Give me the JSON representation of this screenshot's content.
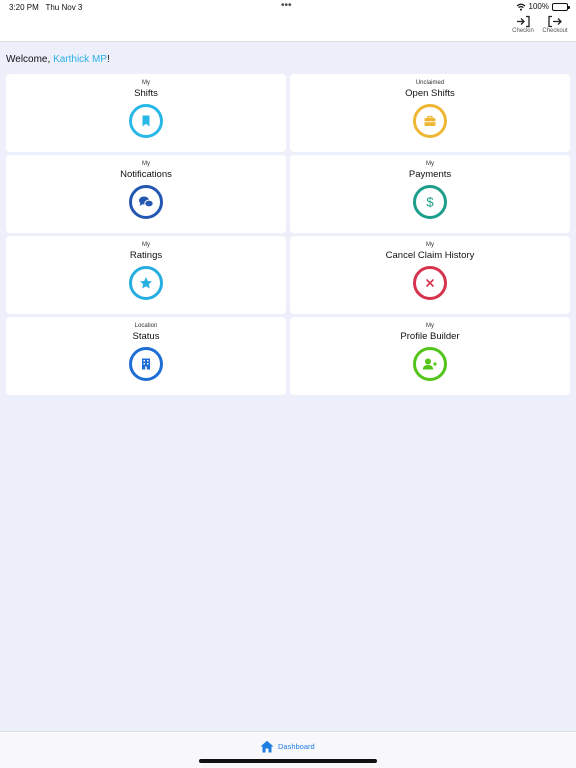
{
  "status_bar": {
    "time": "3:20 PM",
    "date": "Thu Nov 3",
    "battery": "100%"
  },
  "header": {
    "dots": "•••",
    "checkin_label": "Checkin",
    "checkout_label": "Checkout"
  },
  "welcome": {
    "prefix": "Welcome, ",
    "name": "Karthick MP",
    "suffix": "!"
  },
  "cards": [
    {
      "pre": "My",
      "title": "Shifts",
      "icon": "bookmark-icon",
      "color": "#27b8e8"
    },
    {
      "pre": "Unclaimed",
      "title": "Open Shifts",
      "icon": "briefcase-icon",
      "color": "#efb634"
    },
    {
      "pre": "My",
      "title": "Notifications",
      "icon": "chat-icon",
      "color": "#2457b2"
    },
    {
      "pre": "My",
      "title": "Payments",
      "icon": "dollar-icon",
      "color": "#1d9e8a"
    },
    {
      "pre": "My",
      "title": "Ratings",
      "icon": "star-icon",
      "color": "#27aee0"
    },
    {
      "pre": "My",
      "title": "Cancel Claim History",
      "icon": "x-icon",
      "color": "#d7334e"
    },
    {
      "pre": "Location",
      "title": "Status",
      "icon": "building-icon",
      "color": "#1f6ed6"
    },
    {
      "pre": "My",
      "title": "Profile Builder",
      "icon": "user-plus-icon",
      "color": "#52c41a"
    }
  ],
  "tabbar": {
    "dashboard_label": "Dashboard",
    "icon": "home-icon",
    "color": "#1f7de0"
  }
}
